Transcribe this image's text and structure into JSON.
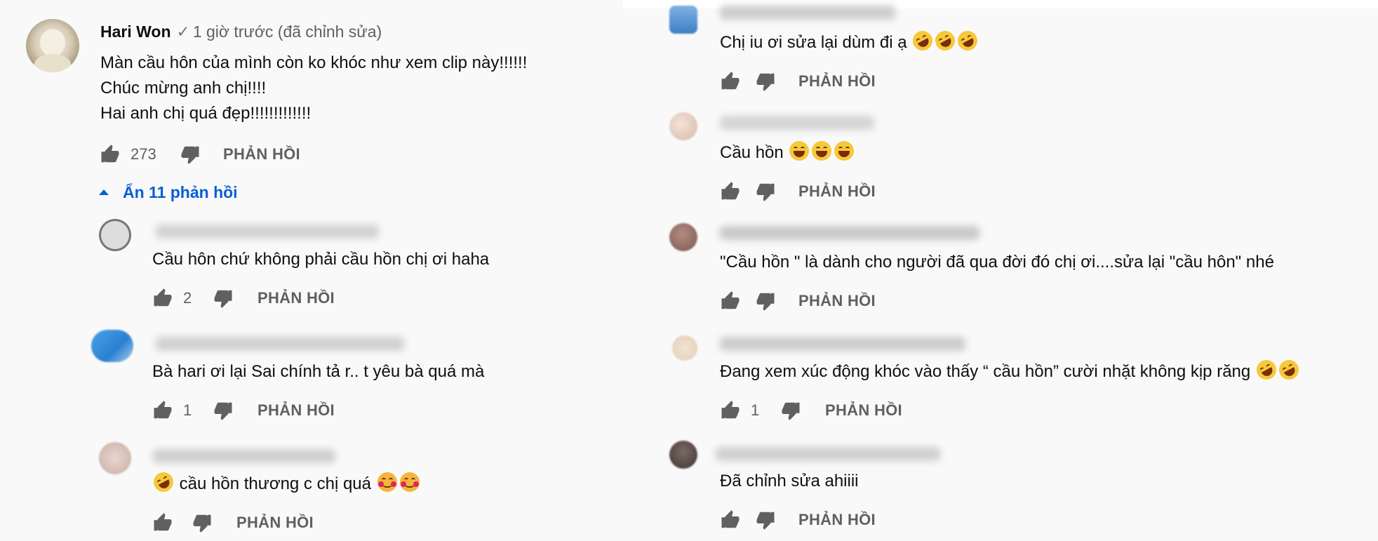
{
  "colors": {
    "background": "#f9f9f9",
    "link": "#065fd4",
    "icon": "#606060",
    "text": "#0f0f0f"
  },
  "comments": [
    {
      "author": "Hari Won",
      "verified": true,
      "time": "1 giờ trước (đã chỉnh sửa)",
      "lines": [
        "Màn cầu hôn của mình còn ko khóc như xem clip này!!!!!!",
        "Chúc mừng anh chị!!!!",
        "Hai anh chị quá đẹp!!!!!!!!!!!!!"
      ],
      "likes": "273",
      "reply_label": "PHẢN HỒI",
      "toggle_label": "Ẩn 11 phản hồi"
    },
    {
      "author_hint": "",
      "lines": [
        "Cầu hôn chứ không phải cầu hồn chị ơi haha"
      ],
      "likes": "2",
      "reply_label": "PHẢN HỒI"
    },
    {
      "author_hint": "...hương Dung Nguyễn  1 giờ...",
      "lines": [
        "Bà hari ơi lại Sai chính tả r.. t yêu bà quá mà"
      ],
      "likes": "1",
      "reply_label": "PHẢN HỒI"
    },
    {
      "author_hint": "...Nguyễn  1 giờ trước",
      "pre_emoji": "rolling-on-floor-laughing",
      "lines": [
        "cầu hồn thương c chị quá"
      ],
      "post_emojis": [
        "smiling-face-with-hearts",
        "smiling-face-with-hearts"
      ],
      "likes": "",
      "reply_label": "PHẢN HỒI"
    },
    {
      "author_hint": "nam ng...            ...ước",
      "lines": [
        "Chị iu ơi  sửa lại dùm đi ạ"
      ],
      "post_emojis": [
        "rolling-on-floor-laughing",
        "rolling-on-floor-laughing",
        "rolling-on-floor-laughing"
      ],
      "likes": "",
      "reply_label": "PHẢN HỒI"
    },
    {
      "author_hint": "Gos Hip  1 giờ trước",
      "lines": [
        "Cầu hồn"
      ],
      "post_emojis": [
        "grinning-squinting-face",
        "grinning-squinting-face",
        "grinning-squinting-face"
      ],
      "likes": "",
      "reply_label": "PHẢN HỒI"
    },
    {
      "author_hint": "Thị Bích Hiền Nguyễn   ...ớc",
      "lines": [
        "\"Cầu hồn \" là dành cho người đã qua đời đó chị ơi....sửa lại \"cầu hôn\" nhé"
      ],
      "likes": "",
      "reply_label": "PHẢN HỒI"
    },
    {
      "author_hint": "Anna Nguyen Vlog  34 phút...",
      "lines": [
        "Đang xem xúc động khóc vào thấy “ cầu hồn” cười nhặt không kịp răng"
      ],
      "post_emojis": [
        "rolling-on-floor-laughing",
        "rolling-on-floor-laughing"
      ],
      "likes": "1",
      "reply_label": "PHẢN HỒI"
    },
    {
      "author_hint": "Diệt linh bi kem  34 phút trước",
      "lines": [
        "Đã chỉnh sửa ahiiii"
      ],
      "likes": "",
      "reply_label": "PHẢN HỒI"
    }
  ]
}
